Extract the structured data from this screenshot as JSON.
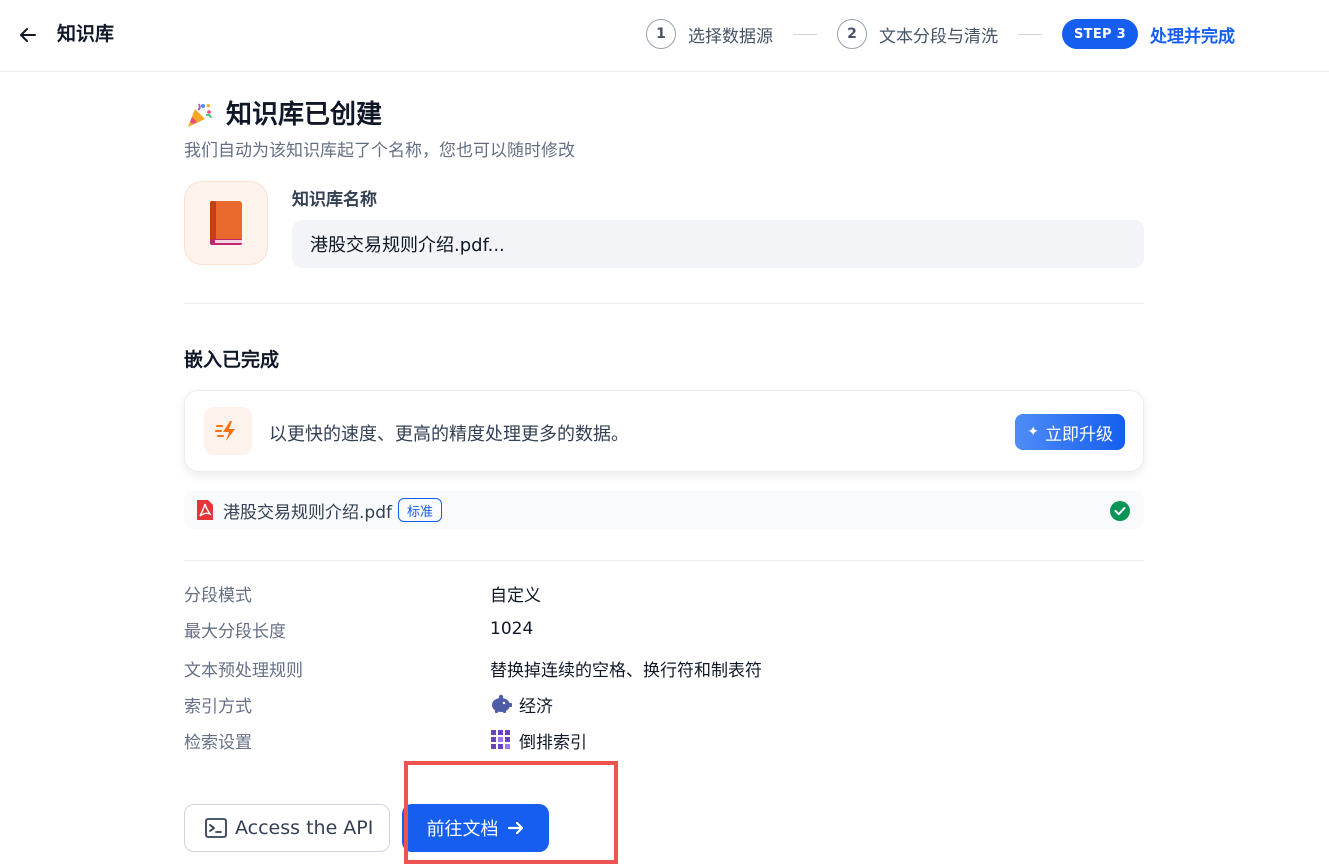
{
  "header": {
    "title": "知识库",
    "steps": [
      {
        "number": "1",
        "label": "选择数据源"
      },
      {
        "number": "2",
        "label": "文本分段与清洗"
      }
    ],
    "active_step": {
      "badge": "STEP 3",
      "label": "处理并完成"
    }
  },
  "main": {
    "title": "知识库已创建",
    "subtitle": "我们自动为该知识库起了个名称，您也可以随时修改",
    "kb_name_label": "知识库名称",
    "kb_name_value": "港股交易规则介绍.pdf...",
    "embed_title": "嵌入已完成",
    "upgrade": {
      "text": "以更快的速度、更高的精度处理更多的数据。",
      "button_label": "立即升级"
    },
    "file": {
      "name": "港股交易规则介绍.pdf",
      "badge": "标准"
    },
    "settings": [
      {
        "key": "分段模式",
        "value": "自定义"
      },
      {
        "key": "最大分段长度",
        "value": "1024"
      },
      {
        "key": "文本预处理规则",
        "value": "替换掉连续的空格、换行符和制表符"
      },
      {
        "key": "索引方式",
        "value": "经济",
        "icon": "piggy-bank-icon"
      },
      {
        "key": "检索设置",
        "value": "倒排索引",
        "icon": "grid-icon"
      }
    ],
    "api_button_label": "Access the API",
    "doc_button_label": "前往文档"
  },
  "colors": {
    "primary": "#155eef",
    "highlight": "#ef5350",
    "success": "#079455",
    "pdf_red": "#e5343a",
    "icon_purple": "#6941c6"
  }
}
